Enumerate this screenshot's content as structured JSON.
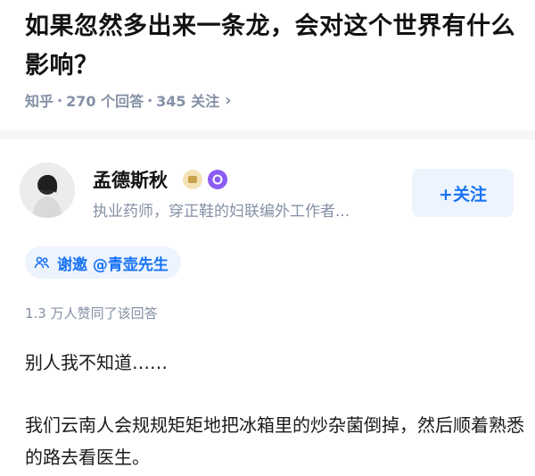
{
  "question": {
    "title": "如果忽然多出来一条龙，会对这个世界有什么影响？"
  },
  "meta": {
    "source": "知乎",
    "answer_count": "270 个回答",
    "follower_count": "345 关注",
    "separator": "·"
  },
  "author": {
    "name": "孟德斯秋",
    "bio": "执业药师，穿正鞋的妇联编外工作者...",
    "badge_icons": [
      "medal-icon",
      "purple-badge-icon"
    ]
  },
  "follow_button": {
    "label": "+关注"
  },
  "invite": {
    "label": "谢邀 @青壶先生"
  },
  "answer": {
    "vote_text": "1.3 万人赞同了该回答",
    "paragraphs": [
      "别人我不知道……",
      "我们云南人会规规矩矩地把冰箱里的炒杂菌倒掉，然后顺着熟悉的路去看医生。"
    ]
  },
  "colors": {
    "accent": "#1772f6",
    "muted": "#8590a6",
    "accent_bg": "#eef4fd"
  }
}
